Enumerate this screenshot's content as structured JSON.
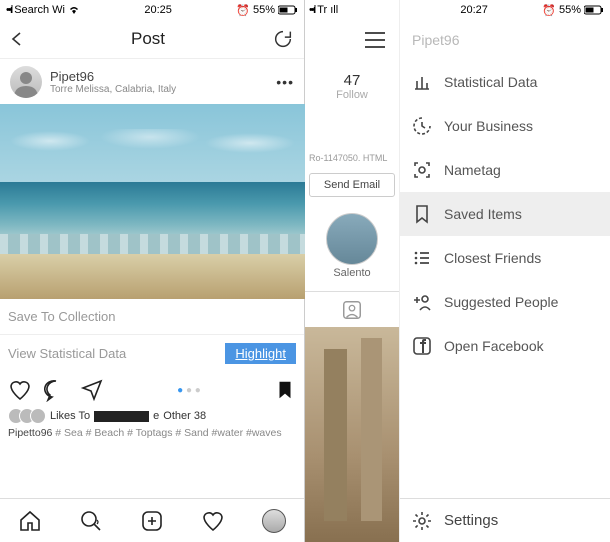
{
  "left": {
    "status": {
      "carrier": "Search Wi",
      "time": "20:25",
      "battery": "55%"
    },
    "titlebar": {
      "title": "Post"
    },
    "post": {
      "username": "Pipet96",
      "location": "Torre Melissa, Calabria, Italy"
    },
    "actions": {
      "save_collection": "Save To Collection",
      "view_stats": "View Statistical Data",
      "highlight": "Highlight"
    },
    "likes": {
      "prefix": "Likes To",
      "suffix_e": "e",
      "others": "Other 38"
    },
    "caption": {
      "user": "Pipetto96",
      "tags": "# Sea # Beach # Toptags # Sand #water #waves"
    }
  },
  "right": {
    "strip": {
      "carrier": "Tr",
      "follow_count": "47",
      "follow_label": "Follow",
      "ro_line": "Ro-1147050. HTML",
      "send_email": "Send Email",
      "story_label": "Salento"
    },
    "status": {
      "time": "20:27",
      "battery": "55%"
    },
    "header_user": "Pipet96",
    "menu": {
      "stats": "Statistical Data",
      "business": "Your Business",
      "nametag": "Nametag",
      "saved": "Saved Items",
      "closest": "Closest Friends",
      "suggested": "Suggested People",
      "facebook": "Open Facebook"
    },
    "settings": "Settings"
  }
}
